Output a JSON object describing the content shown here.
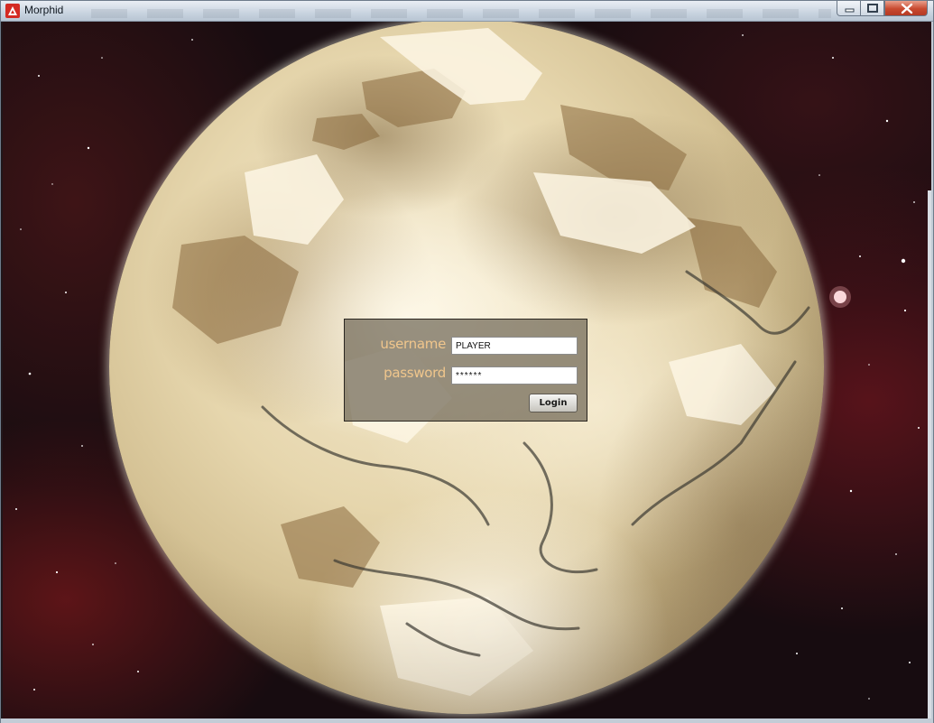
{
  "window": {
    "title": "Morphid",
    "icon": "morphid-app-icon",
    "controls": [
      "minimize-icon",
      "maximize-icon",
      "close-icon"
    ],
    "accent_color": "#c8492f"
  },
  "login": {
    "username_label": "username",
    "password_label": "password",
    "username_value": "PLAYER",
    "password_value": "******",
    "login_button": "Login",
    "label_color": "#f0c68c"
  }
}
